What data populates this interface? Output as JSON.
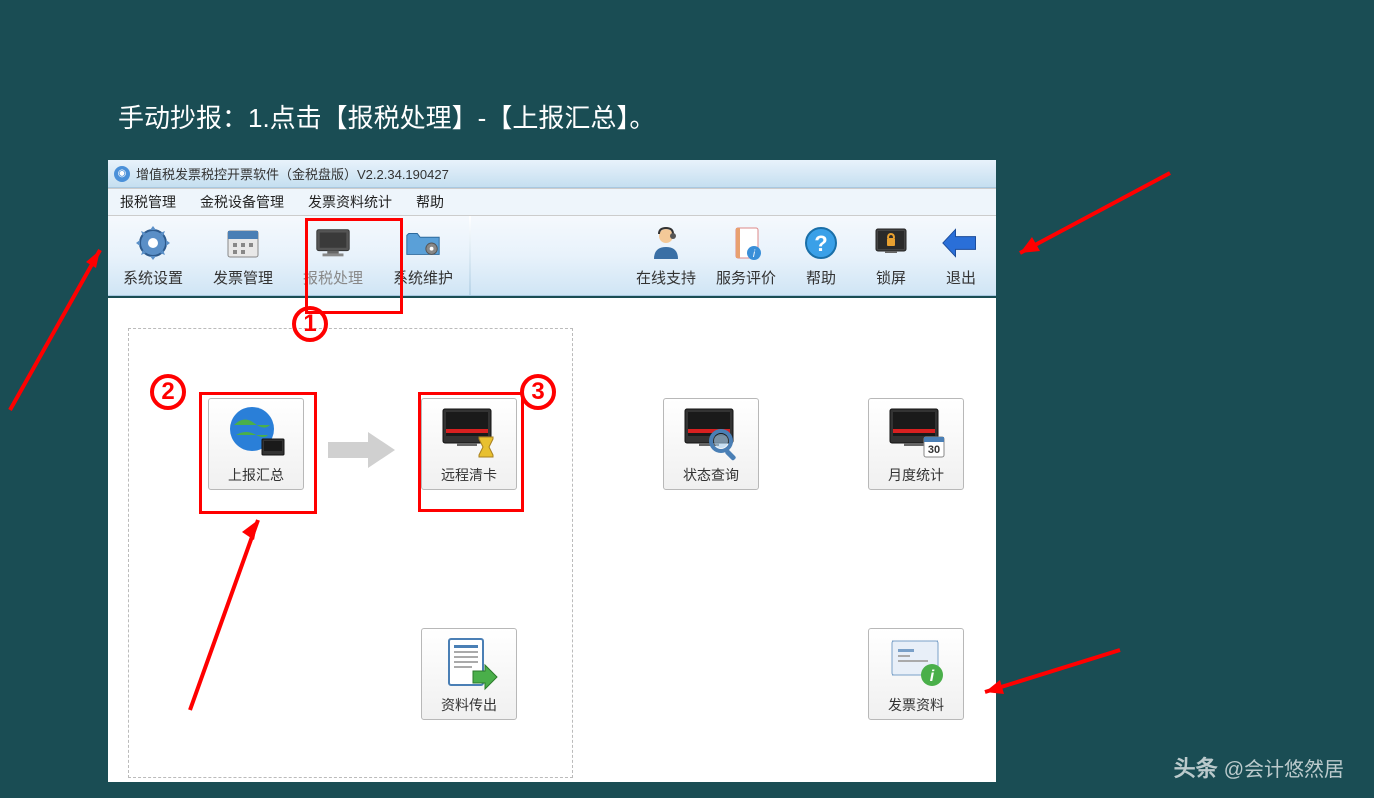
{
  "instruction": "手动抄报：1.点击【报税处理】-【上报汇总】。",
  "titleBar": {
    "title": "增值税发票税控开票软件（金税盘版）V2.2.34.190427"
  },
  "menuBar": {
    "items": [
      "报税管理",
      "金税设备管理",
      "发票资料统计",
      "帮助"
    ]
  },
  "toolbar": {
    "left": [
      {
        "label": "系统设置",
        "icon": "gear"
      },
      {
        "label": "发票管理",
        "icon": "calendar"
      },
      {
        "label": "报税处理",
        "icon": "monitor"
      },
      {
        "label": "系统维护",
        "icon": "folder-gear"
      }
    ],
    "right": [
      {
        "label": "在线支持",
        "icon": "support-person"
      },
      {
        "label": "服务评价",
        "icon": "notebook"
      },
      {
        "label": "帮助",
        "icon": "help"
      },
      {
        "label": "锁屏",
        "icon": "lock-screen"
      },
      {
        "label": "退出",
        "icon": "exit-arrow"
      }
    ]
  },
  "tiles": {
    "upload": "上报汇总",
    "remoteClear": "远程清卡",
    "statusQuery": "状态查询",
    "monthlyStat": "月度统计",
    "dataExport": "资料传出",
    "invoiceData": "发票资料"
  },
  "annotations": {
    "num1": "1",
    "num2": "2",
    "num3": "3"
  },
  "watermark": {
    "logo": "头条",
    "account": "@会计悠然居"
  },
  "colors": {
    "highlight": "#ff0000",
    "bg": "#1a4d54",
    "barGradTop": "#e8f2fb"
  }
}
